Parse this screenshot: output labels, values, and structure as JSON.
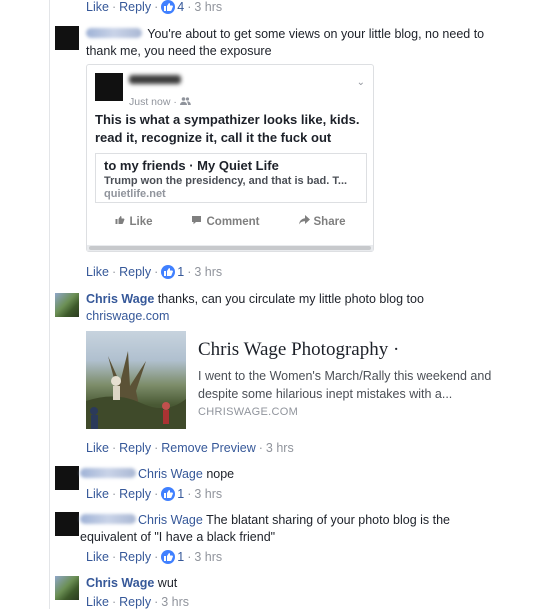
{
  "action_labels": {
    "like": "Like",
    "reply": "Reply",
    "remove_preview": "Remove Preview",
    "separator": "·"
  },
  "comments": [
    {
      "actions_top": {
        "likes": "4",
        "time": "3 hrs"
      }
    },
    {
      "text": "You're about to get some views on your little blog, no need to thank me, you need the exposure",
      "shared_post": {
        "meta": "Just now ·",
        "text": "This is what a sympathizer looks like, kids. read it, recognize it, call it the fuck out",
        "link_title": "to my friends · My Quiet Life",
        "link_desc": "Trump won the presidency, and that is bad. T...",
        "link_host": "quietlife.net",
        "like": "Like",
        "comment": "Comment",
        "share": "Share"
      },
      "likes": "1",
      "time": "3 hrs"
    },
    {
      "author": "Chris Wage",
      "text": "thanks, can you circulate my little photo blog too",
      "link": "chriswage.com",
      "preview": {
        "title": "Chris Wage Photography ·",
        "desc": "I went to the Women's March/Rally this weekend and despite some hilarious inept mistakes with a...",
        "host": "CHRISWAGE.COM"
      },
      "time": "3 hrs"
    },
    {
      "author": "Chris Wage",
      "text": "nope",
      "likes": "1",
      "time": "3 hrs"
    },
    {
      "author": "Chris Wage",
      "text": "The blatant sharing of your photo blog is the equivalent of \"I have a black friend\"",
      "likes": "1",
      "time": "3 hrs"
    },
    {
      "author": "Chris Wage",
      "text": "wut",
      "time": "3 hrs"
    }
  ],
  "colors": {
    "link": "#365899",
    "meta": "#90949c",
    "like_badge": "#4080ff"
  },
  "icons": {
    "like_badge": "thumbs-up-icon",
    "friends": "friends-icon",
    "share": "share-arrow-icon",
    "comment": "comment-bubble-icon"
  }
}
